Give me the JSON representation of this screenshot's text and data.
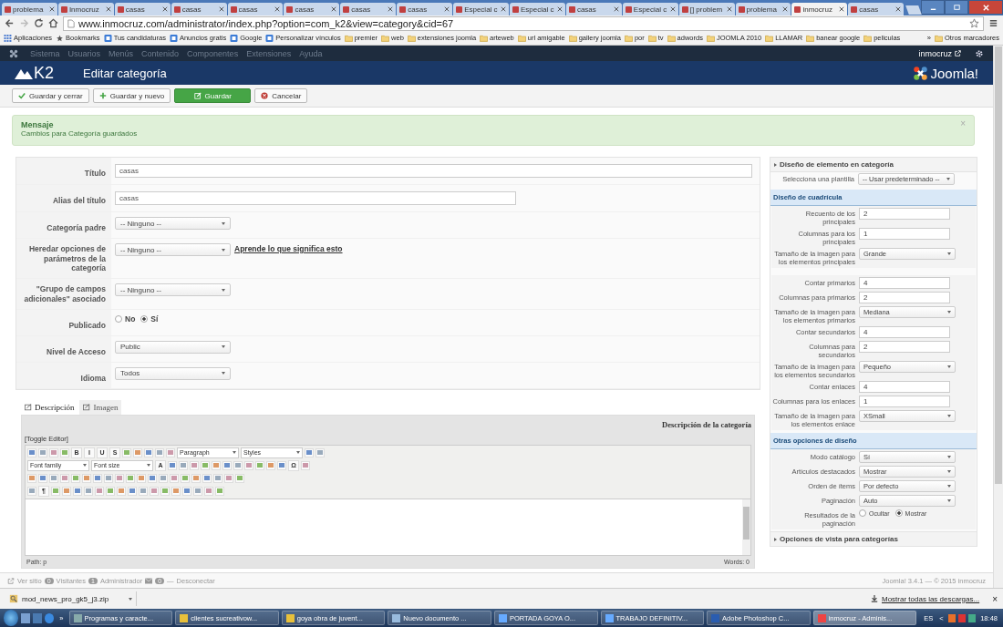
{
  "browser": {
    "tabs": [
      {
        "label": "problema",
        "selected": false
      },
      {
        "label": "Inmocruz",
        "selected": false
      },
      {
        "label": "casas",
        "selected": false
      },
      {
        "label": "casas",
        "selected": false
      },
      {
        "label": "casas",
        "selected": false
      },
      {
        "label": "casas",
        "selected": false
      },
      {
        "label": "casas",
        "selected": false
      },
      {
        "label": "casas",
        "selected": false
      },
      {
        "label": "Especial c",
        "selected": false
      },
      {
        "label": "Especial c",
        "selected": false
      },
      {
        "label": "casas",
        "selected": false
      },
      {
        "label": "Especial c",
        "selected": false
      },
      {
        "label": "[] problem",
        "selected": false
      },
      {
        "label": "problema",
        "selected": false
      },
      {
        "label": "inmocruz",
        "selected": true
      },
      {
        "label": "casas",
        "selected": false
      }
    ],
    "address": "www.inmocruz.com/administrator/index.php?option=com_k2&view=category&cid=67",
    "bookmarks": [
      {
        "label": "Aplicaciones",
        "kind": "apps"
      },
      {
        "label": "Bookmarks",
        "kind": "star"
      },
      {
        "label": "Tus candidaturas",
        "kind": "site"
      },
      {
        "label": "Anuncios gratis",
        "kind": "site"
      },
      {
        "label": "Google",
        "kind": "site"
      },
      {
        "label": "Personalizar vínculos",
        "kind": "site"
      },
      {
        "label": "premier",
        "kind": "folder"
      },
      {
        "label": "web",
        "kind": "folder"
      },
      {
        "label": "extensiones joomla",
        "kind": "folder"
      },
      {
        "label": "arteweb",
        "kind": "folder"
      },
      {
        "label": "url amigable",
        "kind": "folder"
      },
      {
        "label": "gallery joomla",
        "kind": "folder"
      },
      {
        "label": "por",
        "kind": "folder"
      },
      {
        "label": "tv",
        "kind": "folder"
      },
      {
        "label": "adwords",
        "kind": "folder"
      },
      {
        "label": "JOOMLA 2010",
        "kind": "folder"
      },
      {
        "label": "LLAMAR",
        "kind": "folder"
      },
      {
        "label": "banear google",
        "kind": "folder"
      },
      {
        "label": "peliculas",
        "kind": "folder"
      }
    ],
    "bookmarks_more": "»",
    "other_bookmarks": "Otros marcadores"
  },
  "admin_menu": {
    "items": [
      "Sistema",
      "Usuarios",
      "Menús",
      "Contenido",
      "Componentes",
      "Extensiones",
      "Ayuda"
    ],
    "user": "inmocruz"
  },
  "header": {
    "logo": "K2",
    "title": "Editar categoría",
    "brand": "Joomla!"
  },
  "toolbar": [
    {
      "label": "Guardar y cerrar",
      "kind": "save-close"
    },
    {
      "label": "Guardar y nuevo",
      "kind": "save-new"
    },
    {
      "label": "Guardar",
      "kind": "save"
    },
    {
      "label": "Cancelar",
      "kind": "cancel"
    }
  ],
  "message": {
    "title": "Mensaje",
    "text": "Cambios para Categoría guardados",
    "close": "×"
  },
  "form": [
    {
      "label": "Título",
      "kind": "text",
      "value": "casas",
      "wide": true
    },
    {
      "label": "Alias del título",
      "kind": "text",
      "value": "casas",
      "wide": false
    },
    {
      "label": "Categoría padre",
      "kind": "select",
      "value": "-- Ninguno --"
    },
    {
      "label": "Heredar opciones de parámetros de la categoría",
      "kind": "select",
      "value": "-- Ninguno --",
      "link": "Aprende lo que significa esto"
    },
    {
      "label": "\"Grupo de campos adicionales\" asociado",
      "kind": "select",
      "value": "-- Ninguno --"
    },
    {
      "label": "Publicado",
      "kind": "radio",
      "options": [
        {
          "label": "No",
          "selected": false
        },
        {
          "label": "Sí",
          "selected": true
        }
      ]
    },
    {
      "label": "Nivel de Acceso",
      "kind": "select",
      "value": "Public"
    },
    {
      "label": "Idioma",
      "kind": "select",
      "value": "Todos"
    }
  ],
  "right_panel": {
    "header": "Diseño de elemento en categoría",
    "template_row": {
      "label": "Selecciona una plantilla",
      "kind": "select",
      "value": "-- Usar predeterminado --"
    },
    "sections": [
      {
        "title": "Diseño de cuadrícula",
        "groups": [
          [
            {
              "label": "Recuento de los principales",
              "kind": "text",
              "value": "2"
            },
            {
              "label": "Columnas para los principales",
              "kind": "text",
              "value": "1"
            },
            {
              "label": "Tamaño de la imagen para los elementos principales",
              "kind": "select",
              "value": "Grande"
            }
          ],
          [
            {
              "label": "Contar primarios",
              "kind": "text",
              "value": "4"
            },
            {
              "label": "Columnas para primarios",
              "kind": "text",
              "value": "2"
            },
            {
              "label": "Tamaño de la imagen para los elementos primarios",
              "kind": "select",
              "value": "Mediana"
            },
            {
              "label": "Contar secundarios",
              "kind": "text",
              "value": "4"
            },
            {
              "label": "Columnas para secundarios",
              "kind": "text",
              "value": "2"
            },
            {
              "label": "Tamaño de la imagen para los elementos secundarios",
              "kind": "select",
              "value": "Pequeño"
            },
            {
              "label": "Contar enlaces",
              "kind": "text",
              "value": "4"
            },
            {
              "label": "Columnas para los enlaces",
              "kind": "text",
              "value": "1"
            },
            {
              "label": "Tamaño de la imagen para los elementos enlace",
              "kind": "select",
              "value": "XSmall"
            }
          ]
        ]
      },
      {
        "title": "Otras opciones de diseño",
        "groups": [
          [
            {
              "label": "Modo catálogo",
              "kind": "select",
              "value": "Sí"
            },
            {
              "label": "Artículos destacados",
              "kind": "select",
              "value": "Mostrar"
            },
            {
              "label": "Orden de ítems",
              "kind": "select",
              "value": "Por defecto"
            },
            {
              "label": "Paginación",
              "kind": "select",
              "value": "Auto"
            },
            {
              "label": "Resultados de la paginación",
              "kind": "radio",
              "options": [
                {
                  "label": "Ocultar",
                  "selected": false
                },
                {
                  "label": "Mostrar",
                  "selected": true
                }
              ]
            }
          ]
        ]
      }
    ],
    "footer_header": "Opciones de vista para categorías"
  },
  "editor": {
    "tabs": [
      {
        "label": "Descripción",
        "selected": true
      },
      {
        "label": "Imagen",
        "selected": false
      }
    ],
    "caption": "Descripción de la categoría",
    "toggle": "[Toggle Editor]",
    "toolbar_rows": [
      [
        {
          "kind": "icon"
        },
        {
          "kind": "icon"
        },
        {
          "kind": "icon"
        },
        {
          "kind": "icon"
        },
        {
          "kind": "text",
          "label": "B"
        },
        {
          "kind": "text",
          "label": "I"
        },
        {
          "kind": "text",
          "label": "U"
        },
        {
          "kind": "text",
          "label": "S"
        },
        {
          "kind": "icon"
        },
        {
          "kind": "icon"
        },
        {
          "kind": "icon"
        },
        {
          "kind": "icon"
        },
        {
          "kind": "icon"
        },
        {
          "kind": "select",
          "label": "Paragraph"
        },
        {
          "kind": "select",
          "label": "Styles"
        },
        {
          "kind": "icon"
        },
        {
          "kind": "icon"
        }
      ],
      [
        {
          "kind": "select",
          "label": "Font family"
        },
        {
          "kind": "select",
          "label": "Font size"
        },
        {
          "kind": "text",
          "label": "A"
        },
        {
          "kind": "icon"
        },
        {
          "kind": "icon"
        },
        {
          "kind": "icon"
        },
        {
          "kind": "icon"
        },
        {
          "kind": "icon"
        },
        {
          "kind": "icon"
        },
        {
          "kind": "icon"
        },
        {
          "kind": "icon"
        },
        {
          "kind": "icon"
        },
        {
          "kind": "icon"
        },
        {
          "kind": "icon"
        },
        {
          "kind": "text",
          "label": "Ω"
        },
        {
          "kind": "icon"
        }
      ],
      [
        {
          "kind": "icon"
        },
        {
          "kind": "icon"
        },
        {
          "kind": "icon"
        },
        {
          "kind": "icon"
        },
        {
          "kind": "icon"
        },
        {
          "kind": "icon"
        },
        {
          "kind": "icon"
        },
        {
          "kind": "icon"
        },
        {
          "kind": "icon"
        },
        {
          "kind": "icon"
        },
        {
          "kind": "icon"
        },
        {
          "kind": "icon"
        },
        {
          "kind": "icon"
        },
        {
          "kind": "icon"
        },
        {
          "kind": "icon"
        },
        {
          "kind": "icon"
        },
        {
          "kind": "icon"
        },
        {
          "kind": "icon"
        },
        {
          "kind": "icon"
        },
        {
          "kind": "icon"
        }
      ],
      [
        {
          "kind": "icon"
        },
        {
          "kind": "text",
          "label": "¶"
        },
        {
          "kind": "icon"
        },
        {
          "kind": "icon"
        },
        {
          "kind": "icon"
        },
        {
          "kind": "icon"
        },
        {
          "kind": "icon"
        },
        {
          "kind": "icon"
        },
        {
          "kind": "icon"
        },
        {
          "kind": "icon"
        },
        {
          "kind": "icon"
        },
        {
          "kind": "icon"
        },
        {
          "kind": "icon"
        },
        {
          "kind": "icon"
        },
        {
          "kind": "icon"
        },
        {
          "kind": "icon"
        },
        {
          "kind": "icon"
        },
        {
          "kind": "icon"
        }
      ]
    ],
    "path": "Path: p",
    "words": "Words: 0"
  },
  "status_bar": {
    "view_site": "Ver sitio",
    "visitors_count": "0",
    "visitors": "Visitantes",
    "admins_count": "1",
    "admins": "Administrador",
    "messages_count": "0",
    "separator": "—",
    "logout": "Desconectar",
    "version": "Joomla! 3.4.1 — © 2015 inmocruz"
  },
  "downloads": {
    "file": "mod_news_pro_gk5_j3.zip",
    "show_all": "Mostrar todas las descargas...",
    "close": "×"
  },
  "taskbar": {
    "more": "»",
    "tasks": [
      {
        "label": "Programas y caracte...",
        "selected": false
      },
      {
        "label": "clientes sucreativow...",
        "selected": false
      },
      {
        "label": "goya obra de juvent...",
        "selected": false
      },
      {
        "label": "Nuevo documento ...",
        "selected": false
      },
      {
        "label": "PORTADA GOYA O...",
        "selected": false
      },
      {
        "label": "TRABAJO DEFINITIV...",
        "selected": false
      },
      {
        "label": "Adobe Photoshop C...",
        "selected": false
      },
      {
        "label": "inmocruz - Adminis...",
        "selected": true
      }
    ],
    "language": "ES",
    "tray_arrow": "<",
    "time": "18:48"
  }
}
